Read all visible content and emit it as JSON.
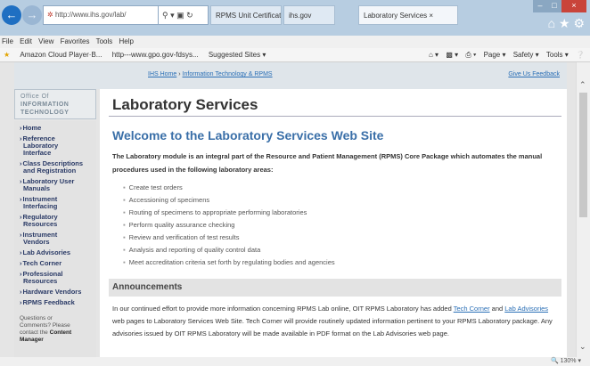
{
  "browser": {
    "address": "http://www.ihs.gov/lab/",
    "tabs": [
      "RPMS Unit Certification",
      "ihs.gov",
      "Laboratory Services"
    ],
    "menu": [
      "File",
      "Edit",
      "View",
      "Favorites",
      "Tools",
      "Help"
    ],
    "favorites": [
      "Amazon Cloud Player·B...",
      "http---www.gpo.gov-fdsys...",
      "Suggested Sites ▾"
    ],
    "toolbar_right": [
      "Page ▾",
      "Safety ▾",
      "Tools ▾"
    ],
    "zoom": "🔍 130%  ▾"
  },
  "site": {
    "logo_line1": "Office Of",
    "logo_line2": "INFORMATION",
    "logo_line3": "TECHNOLOGY",
    "breadcrumb_home": "IHS Home",
    "breadcrumb_sep1": " › ",
    "breadcrumb_oit": "Information Technology & RPMS",
    "feedback": "Give Us Feedback"
  },
  "sidebar": {
    "items": [
      [
        "Home"
      ],
      [
        "Reference",
        "Laboratory",
        "Interface"
      ],
      [
        "Class Descriptions",
        "and Registration"
      ],
      [
        "Laboratory User",
        "Manuals"
      ],
      [
        "Instrument",
        "Interfacing"
      ],
      [
        "Regulatory",
        "Resources"
      ],
      [
        "Instrument",
        "Vendors"
      ],
      [
        "Lab Advisories"
      ],
      [
        "Tech Corner"
      ],
      [
        "Professional",
        "Resources"
      ],
      [
        "Hardware Vendors"
      ],
      [
        "RPMS Feedback"
      ]
    ],
    "note_lines": [
      "Questions or",
      "Comments? Please",
      "contact the"
    ],
    "note_bold": "Content",
    "note_last": "Manager"
  },
  "main": {
    "page_title": "Laboratory Services",
    "welcome": "Welcome to the Laboratory Services Web Site",
    "intro": "The Laboratory module is an integral part of the Resource and Patient Management (RPMS) Core Package which automates the manual procedures used in the following laboratory areas:",
    "bullets": [
      "Create test orders",
      "Accessioning  of specimens",
      "Routing of specimens to appropriate performing laboratories",
      "Perform quality assurance checking",
      "Review and verification of test results",
      "Analysis and reporting of quality control data",
      "Meet accreditation criteria set forth by regulating bodies and agencies"
    ],
    "announcements": "Announcements",
    "ann_p1": "In our continued effort to provide more information concerning RPMS Lab online, OIT RPMS Laboratory has added ",
    "ann_link1": "Tech Corner",
    "ann_p2": " and ",
    "ann_link2": "Lab Advisories",
    "ann_p3": " web pages to Laboratory Services Web Site. Tech Corner will provide routinely updated information pertinent to your RPMS Laboratory package. Any advisories issued by OIT RPMS Laboratory will be made available in PDF format on the Lab Advisories web page."
  }
}
